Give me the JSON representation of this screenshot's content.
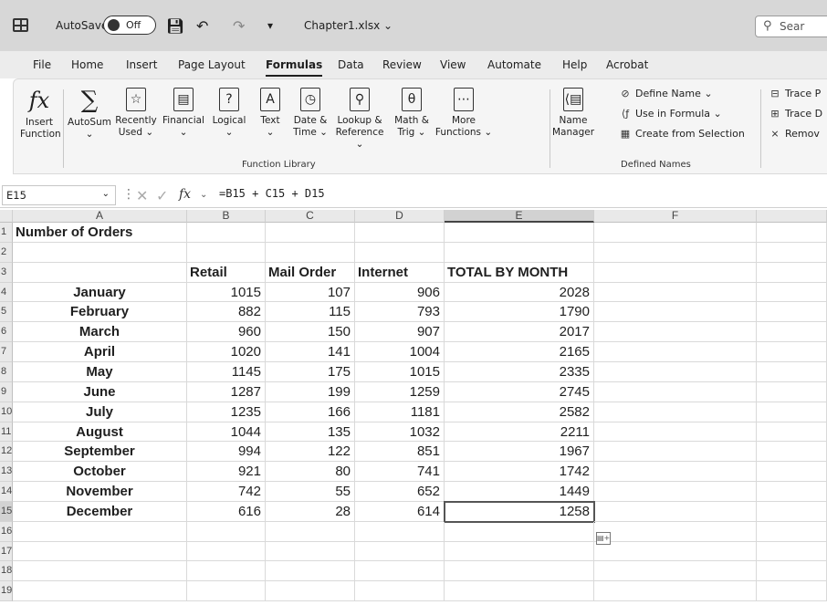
{
  "titlebar": {
    "autosave": "AutoSave",
    "toggle": "Off",
    "filename": "Chapter1.xlsx",
    "search": "Sear"
  },
  "menu": [
    "File",
    "Home",
    "Insert",
    "Page Layout",
    "Formulas",
    "Data",
    "Review",
    "View",
    "Automate",
    "Help",
    "Acrobat"
  ],
  "ribbon": {
    "insert_function": [
      "Insert",
      "Function"
    ],
    "autosum": [
      "AutoSum",
      "⌄"
    ],
    "recently_used": [
      "Recently",
      "Used ⌄"
    ],
    "financial": [
      "Financial",
      "⌄"
    ],
    "logical": [
      "Logical",
      "⌄"
    ],
    "text": [
      "Text",
      "⌄"
    ],
    "date_time": [
      "Date &",
      "Time ⌄"
    ],
    "lookup": [
      "Lookup &",
      "Reference ⌄"
    ],
    "math": [
      "Math &",
      "Trig ⌄"
    ],
    "more": [
      "More",
      "Functions ⌄"
    ],
    "function_library": "Function Library",
    "name_manager": [
      "Name",
      "Manager"
    ],
    "define_name": "Define Name ⌄",
    "use_in_formula": "Use in Formula ⌄",
    "create_from_selection": "Create from Selection",
    "defined_names": "Defined Names",
    "trace_precedents": "Trace P",
    "trace_dependents": "Trace D",
    "remove_arrows": "Remov"
  },
  "formula_bar": {
    "cell": "E15",
    "formula": "=B15 + C15 + D15"
  },
  "columns": [
    "A",
    "B",
    "C",
    "D",
    "E",
    "F"
  ],
  "rows": [
    "1",
    "2",
    "3",
    "4",
    "5",
    "6",
    "7",
    "8",
    "9",
    "10",
    "11",
    "12",
    "13",
    "14",
    "15",
    "16",
    "17",
    "18",
    "19"
  ],
  "sheet": {
    "title": "Number of Orders",
    "headers": [
      "Retail",
      "Mail Order",
      "Internet",
      "TOTAL BY MONTH"
    ],
    "data": [
      [
        "January",
        "1015",
        "107",
        "906",
        "2028"
      ],
      [
        "February",
        "882",
        "115",
        "793",
        "1790"
      ],
      [
        "March",
        "960",
        "150",
        "907",
        "2017"
      ],
      [
        "April",
        "1020",
        "141",
        "1004",
        "2165"
      ],
      [
        "May",
        "1145",
        "175",
        "1015",
        "2335"
      ],
      [
        "June",
        "1287",
        "199",
        "1259",
        "2745"
      ],
      [
        "July",
        "1235",
        "166",
        "1181",
        "2582"
      ],
      [
        "August",
        "1044",
        "135",
        "1032",
        "2211"
      ],
      [
        "September",
        "994",
        "122",
        "851",
        "1967"
      ],
      [
        "October",
        "921",
        "80",
        "741",
        "1742"
      ],
      [
        "November",
        "742",
        "55",
        "652",
        "1449"
      ],
      [
        "December",
        "616",
        "28",
        "614",
        "1258"
      ]
    ]
  }
}
